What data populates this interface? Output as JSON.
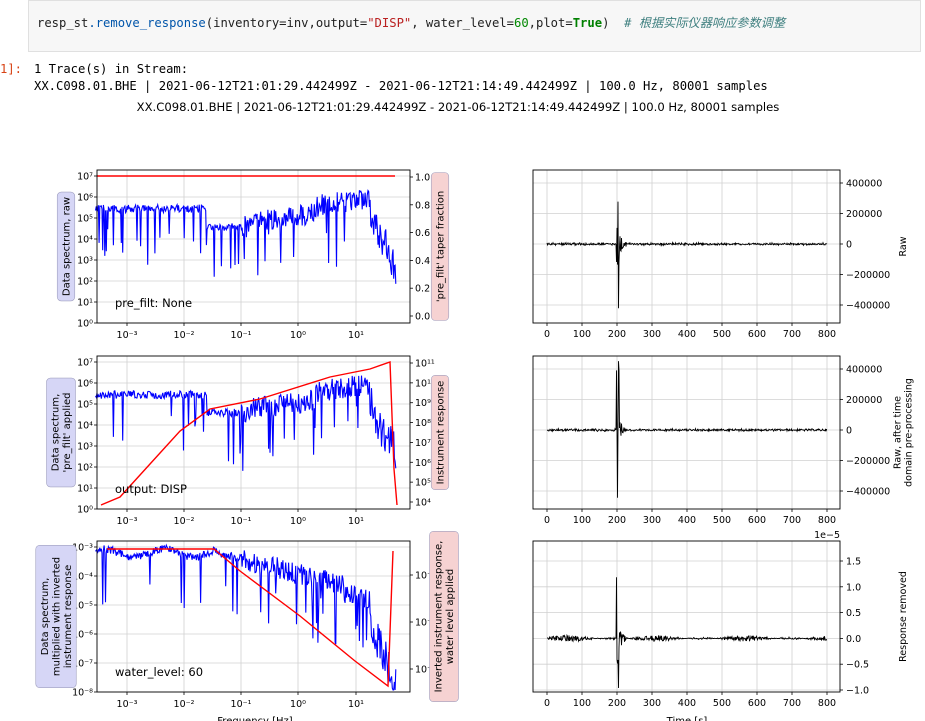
{
  "code": {
    "receiver": "resp_st",
    "method": ".remove_response",
    "open": "(inventory=inv,output=",
    "output_value": "\"DISP\"",
    "mid1": ", water_level=",
    "water_level_value": "60",
    "mid2": ",plot=",
    "plot_value": "True",
    "close": ")  ",
    "comment": "# 根据实际仪器响应参数调整"
  },
  "output": {
    "prompt": "1]:",
    "line1": "1 Trace(s) in Stream:",
    "line2": "XX.C098.01.BHE | 2021-06-12T21:01:29.442499Z - 2021-06-12T21:14:49.442499Z | 100.0 Hz, 80001 samples"
  },
  "figure": {
    "suptitle": "XX.C098.01.BHE | 2021-06-12T21:01:29.442499Z - 2021-06-12T21:14:49.442499Z | 100.0 Hz, 80001 samples",
    "left_x_ticks": [
      "10⁻³",
      "10⁻²",
      "10⁻¹",
      "10⁰",
      "10¹"
    ],
    "right_x_ticks": [
      "0",
      "100",
      "200",
      "300",
      "400",
      "500",
      "600",
      "700",
      "800"
    ],
    "left_xlabel": "Frequency [Hz]",
    "right_xlabel": "Time [s]",
    "rows": [
      {
        "left_ylabel": [
          "Data spectrum, raw"
        ],
        "left_yticks": [
          "10⁷",
          "10⁶",
          "10⁵",
          "10⁴",
          "10³",
          "10²",
          "10¹",
          "10⁰"
        ],
        "twin_ylabel": [
          "'pre_filt' taper fraction"
        ],
        "twin_yticks": [
          "1.0",
          "0.8",
          "0.6",
          "0.4",
          "0.2",
          "0.0"
        ],
        "annotation": "pre_filt: None",
        "right_yticks": [
          "400000",
          "200000",
          "0",
          "−200000",
          "−400000"
        ],
        "right_ylabel": [
          "Raw"
        ],
        "offset_text": ""
      },
      {
        "left_ylabel": [
          "Data spectrum,",
          "'pre_filt' applied"
        ],
        "left_yticks": [
          "10⁷",
          "10⁶",
          "10⁵",
          "10⁴",
          "10³",
          "10²",
          "10¹",
          "10⁰"
        ],
        "twin_ylabel": [
          "Instrument response"
        ],
        "twin_yticks": [
          "10¹¹",
          "10¹⁰",
          "10⁹",
          "10⁸",
          "10⁷",
          "10⁶",
          "10⁵",
          "10⁴"
        ],
        "annotation": "output: DISP",
        "right_yticks": [
          "400000",
          "200000",
          "0",
          "−200000",
          "−400000"
        ],
        "right_ylabel": [
          "Raw, after time",
          "domain pre-processing"
        ],
        "offset_text": "1e−5"
      },
      {
        "left_ylabel": [
          "Data spectrum,",
          "multiplied with inverted",
          "instrument response"
        ],
        "left_yticks": [
          "10⁻³",
          "10⁻⁴",
          "10⁻⁵",
          "10⁻⁶",
          "10⁻⁷",
          "10⁻⁸"
        ],
        "twin_ylabel": [
          "Inverted instrument response,",
          "water level applied"
        ],
        "twin_yticks": [
          "10⁻⁹",
          "10⁻¹⁰",
          "10⁻¹¹"
        ],
        "annotation": "water_level: 60",
        "right_yticks": [
          "1.5",
          "1.0",
          "0.5",
          "0.0",
          "−0.5",
          "−1.0"
        ],
        "right_ylabel": [
          "Response removed"
        ],
        "offset_text": ""
      }
    ],
    "colors": {
      "spectrum": "#0000ff",
      "response": "#ff0000",
      "trace": "#000000",
      "label_blue_bg": "#d6d6f6",
      "label_red_bg": "#f6d2d2"
    }
  }
}
